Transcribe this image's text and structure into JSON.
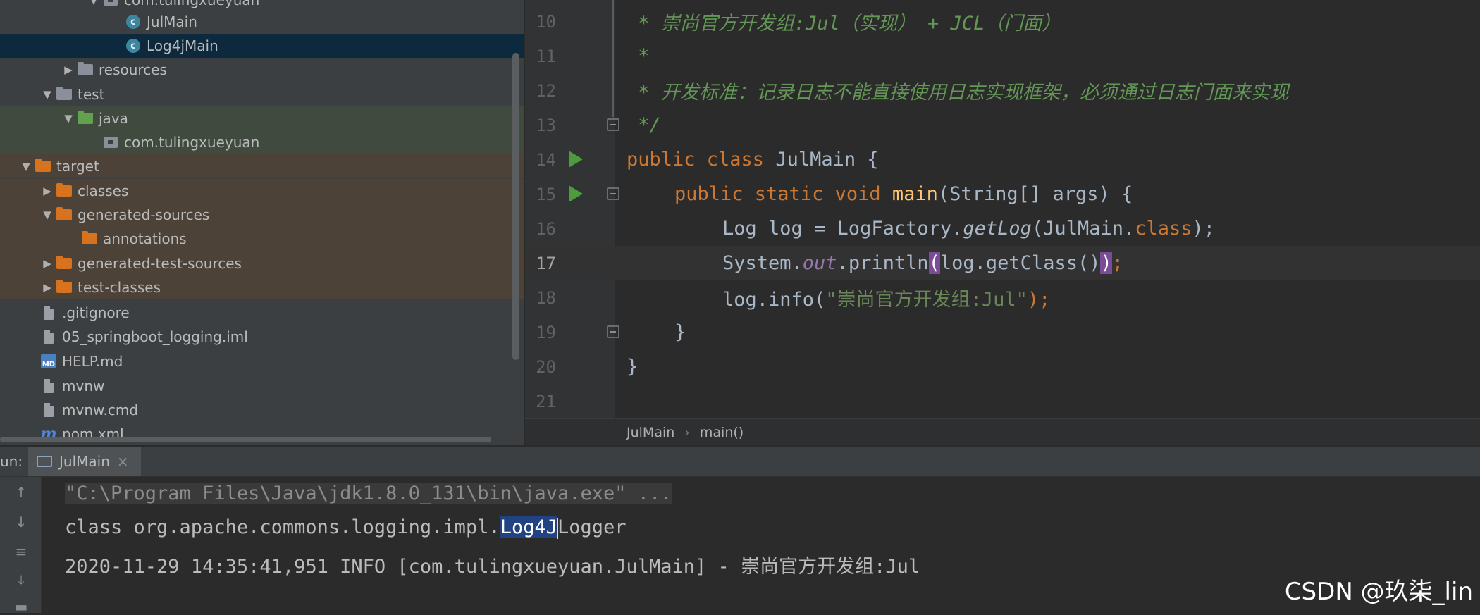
{
  "tree": {
    "items": [
      {
        "label": "com.tulingxueyuan",
        "icon": "package-icon",
        "arrow": "expanded"
      },
      {
        "label": "JulMain",
        "icon": "class-icon",
        "arrow": ""
      },
      {
        "label": "Log4jMain",
        "icon": "class-icon",
        "arrow": "",
        "selected": true
      },
      {
        "label": "resources",
        "icon": "resources-folder-icon",
        "arrow": "collapsed"
      },
      {
        "label": "test",
        "icon": "folder-icon",
        "arrow": "expanded"
      },
      {
        "label": "java",
        "icon": "test-source-folder-icon",
        "arrow": "expanded"
      },
      {
        "label": "com.tulingxueyuan",
        "icon": "package-icon",
        "arrow": ""
      },
      {
        "label": "target",
        "icon": "excluded-folder-icon",
        "arrow": "expanded"
      },
      {
        "label": "classes",
        "icon": "excluded-folder-icon",
        "arrow": "collapsed"
      },
      {
        "label": "generated-sources",
        "icon": "excluded-folder-icon",
        "arrow": "expanded"
      },
      {
        "label": "annotations",
        "icon": "excluded-folder-icon",
        "arrow": ""
      },
      {
        "label": "generated-test-sources",
        "icon": "excluded-folder-icon",
        "arrow": "collapsed"
      },
      {
        "label": "test-classes",
        "icon": "excluded-folder-icon",
        "arrow": "collapsed"
      },
      {
        "label": ".gitignore",
        "icon": "file-icon",
        "arrow": ""
      },
      {
        "label": "05_springboot_logging.iml",
        "icon": "file-icon",
        "arrow": ""
      },
      {
        "label": "HELP.md",
        "icon": "markdown-icon",
        "arrow": ""
      },
      {
        "label": "mvnw",
        "icon": "file-icon",
        "arrow": ""
      },
      {
        "label": "mvnw.cmd",
        "icon": "file-icon",
        "arrow": ""
      },
      {
        "label": "pom.xml",
        "icon": "maven-icon",
        "arrow": ""
      }
    ]
  },
  "editor": {
    "lines": [
      {
        "n": "10",
        "t": " * 崇尚官方开发组:Jul（实现） + JCL（门面）"
      },
      {
        "n": "11",
        "t": " *"
      },
      {
        "n": "12",
        "t": " * 开发标准：记录日志不能直接使用日志实现框架，必须通过日志门面来实现"
      },
      {
        "n": "13",
        "t": " */"
      },
      {
        "n": "14",
        "kw1": "public class ",
        "cls": "JulMain {"
      },
      {
        "n": "15",
        "kw1": "public static void ",
        "fn": "main",
        "rest": "(String[] args) {"
      },
      {
        "n": "16",
        "a": "Log log = LogFactory.",
        "i": "getLog",
        "b": "(JulMain.",
        "k": "class",
        "c": ");"
      },
      {
        "n": "17",
        "a": "System.",
        "f": "out",
        "b": ".println",
        "p1": "(",
        "c": "log.getClass()",
        "p2": ")",
        "d": ";"
      },
      {
        "n": "18",
        "a": "log.info(",
        "s": "\"崇尚官方开发组:Jul\"",
        "b": ");"
      },
      {
        "n": "19",
        "t": "}"
      },
      {
        "n": "20",
        "t": "}"
      },
      {
        "n": "21",
        "t": ""
      }
    ],
    "breadcrumb": {
      "cls": "JulMain",
      "sep": "›",
      "method": "main()"
    }
  },
  "run": {
    "label": "un:",
    "tab": "JulMain",
    "close": "×",
    "lines": {
      "cmd": "\"C:\\Program Files\\Java\\jdk1.8.0_131\\bin\\java.exe\" ...",
      "l2_pre": "class org.apache.commons.logging.impl.",
      "l2_sel": "Log4J",
      "l2_post": "Logger",
      "l3": "2020-11-29 14:35:41,951 INFO [com.tulingxueyuan.JulMain] - 崇尚官方开发组:Jul"
    }
  },
  "watermark": "CSDN @玖柒_lin"
}
